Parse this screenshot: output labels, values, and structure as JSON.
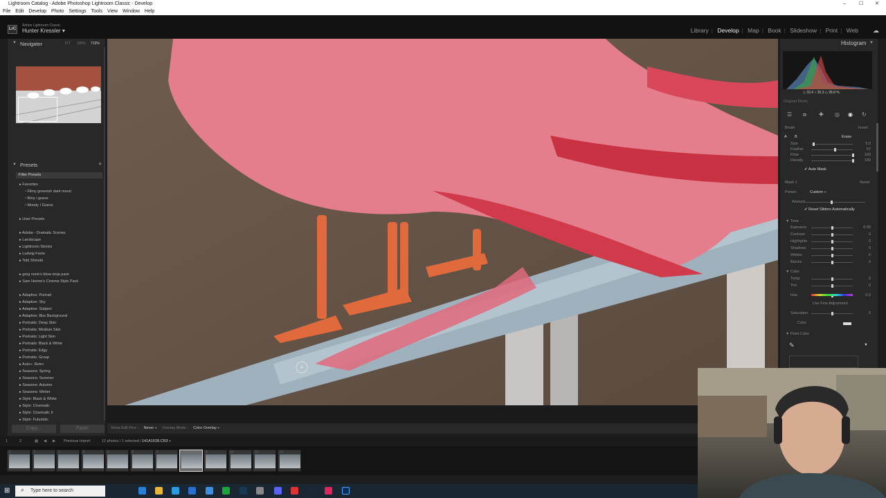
{
  "window": {
    "title": "Lightroom Catalog - Adobe Photoshop Lightroom Classic - Develop",
    "controls": [
      "–",
      "☐",
      "✕"
    ]
  },
  "menu": [
    "File",
    "Edit",
    "Develop",
    "Photo",
    "Settings",
    "Tools",
    "View",
    "Window",
    "Help"
  ],
  "identity": {
    "badge": "LrC",
    "product": "Adobe Lightroom Classic",
    "user": "Hunter Kressler",
    "caret": "▾"
  },
  "modules": [
    "Library",
    "Develop",
    "Map",
    "Book",
    "Slideshow",
    "Print",
    "Web"
  ],
  "active_module": "Develop",
  "navigator": {
    "title": "Navigator",
    "zoom_options": [
      "FIT",
      "100%",
      "713%"
    ]
  },
  "presets": {
    "title": "Presets",
    "add": "+",
    "filter": "Filter Presets",
    "favorites": "Favorites",
    "favorites_items": [
      "Filmy greenish dark mood",
      "filmy i guess",
      "Moody I Guess"
    ],
    "groups": [
      "User Presets",
      "Adobe - Dramatic Scenes",
      "Landscape",
      "Lightroom Stories",
      "Ludwig Favte",
      "Tobi Shinobi",
      "greg norie's blow ninja pack",
      "Sam Horine's Cinema Style Pack",
      "Adaptive: Portrait",
      "Adaptive: Sky",
      "Adaptive: Subject",
      "Adaptive: Blur Background",
      "Portraits: Deep Skin",
      "Portraits: Medium Skin",
      "Portraits: Light Skin",
      "Portraits: Black & White",
      "Portraits: Edgy",
      "Portraits: Group",
      "Auto+: Retro",
      "Seasons: Spring",
      "Seasons: Summer",
      "Seasons: Autumn",
      "Seasons: Winter",
      "Style: Black & White",
      "Style: Cinematic",
      "Style: Cinematic II",
      "Style: Futuristic"
    ]
  },
  "copy_label": "Copy...",
  "paste_label": "Paste",
  "toolbar": {
    "show_edit_pins": "Show Edit Pins :",
    "never": "Never ÷",
    "overlay_mode": "Overlay Mode :",
    "color_overlay": "Color Overlay ÷"
  },
  "histogram": {
    "title": "Histogram",
    "values": "◇ 33.4  ○ 30.3  ◇ 28.8 %",
    "original_photo": "Original Photo"
  },
  "brush": {
    "label": "Brush",
    "invert": "Invert",
    "a": "A",
    "b": "B",
    "erase": "Erase",
    "rows": [
      {
        "label": "Size",
        "value": "5.0"
      },
      {
        "label": "Feather",
        "value": "57"
      },
      {
        "label": "Flow",
        "value": "100"
      },
      {
        "label": "Density",
        "value": "100"
      }
    ],
    "auto_mask": "Auto Mask"
  },
  "mask": {
    "label": "Mask 1",
    "reset": "Reset",
    "preset_label": "Preset :",
    "preset_value": "Custom ÷",
    "amount": "Amount",
    "reset_sliders": "Reset Sliders Automatically"
  },
  "tone": {
    "title": "Tone",
    "rows": [
      "Exposure",
      "Contrast",
      "Highlights",
      "Shadows",
      "Whites",
      "Blacks"
    ],
    "values": [
      "0.00",
      "0",
      "0",
      "0",
      "0",
      "0"
    ]
  },
  "color": {
    "title": "Color",
    "rows": [
      "Temp",
      "Tint",
      "Hue",
      "Saturation"
    ],
    "values": [
      "0",
      "0",
      "0.0",
      "0"
    ],
    "fine": "Use Fine Adjustment",
    "color_label": "Color"
  },
  "point_color": {
    "title": "Point Color"
  },
  "filmstrip": {
    "source": "Previous Import",
    "count": "12 photos / 1 selected /",
    "file": "141A1628.CR3 ÷",
    "page1": "1",
    "page2": "2",
    "thumbs": 12
  },
  "taskbar": {
    "search": "Type here to search"
  }
}
